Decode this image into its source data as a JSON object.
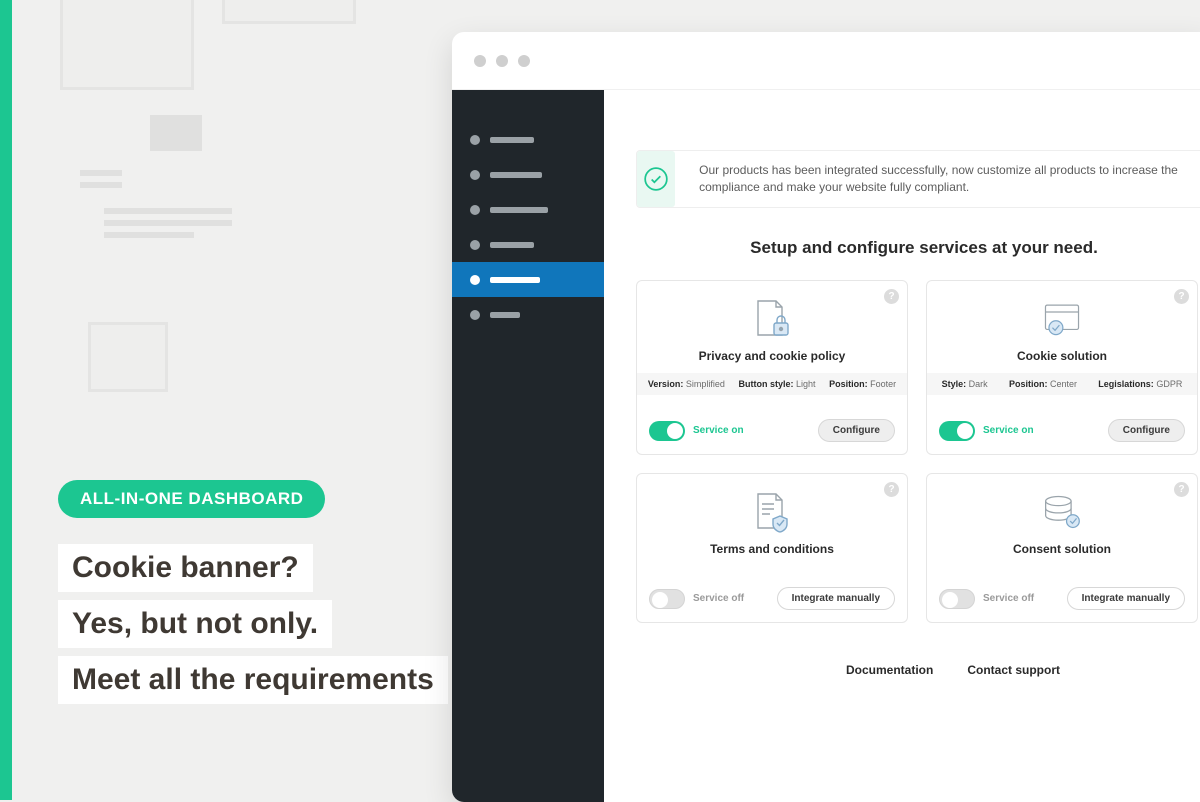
{
  "accent_color": "#1cc691",
  "marketing": {
    "pill": "ALL-IN-ONE DASHBOARD",
    "line1": "Cookie banner?",
    "line2": "Yes, but not only.",
    "line3": "Meet all the requirements"
  },
  "alert": {
    "text": "Our products has been integrated successfully, now customize all products to increase the compliance and make your website fully compliant."
  },
  "section_title": "Setup and configure services at your need.",
  "cards": {
    "privacy": {
      "title": "Privacy and cookie policy",
      "meta": [
        {
          "k": "Version:",
          "v": "Simplified"
        },
        {
          "k": "Button style:",
          "v": "Light"
        },
        {
          "k": "Position:",
          "v": "Footer"
        }
      ],
      "service_label": "Service on",
      "button": "Configure"
    },
    "cookie": {
      "title": "Cookie solution",
      "meta": [
        {
          "k": "Style:",
          "v": "Dark"
        },
        {
          "k": "Position:",
          "v": "Center"
        },
        {
          "k": "Legislations:",
          "v": "GDPR"
        }
      ],
      "service_label": "Service on",
      "button": "Configure"
    },
    "terms": {
      "title": "Terms and conditions",
      "service_label": "Service off",
      "button": "Integrate manually"
    },
    "consent": {
      "title": "Consent solution",
      "service_label": "Service off",
      "button": "Integrate manually"
    }
  },
  "help_glyph": "?",
  "footer": {
    "doc": "Documentation",
    "support": "Contact support"
  }
}
